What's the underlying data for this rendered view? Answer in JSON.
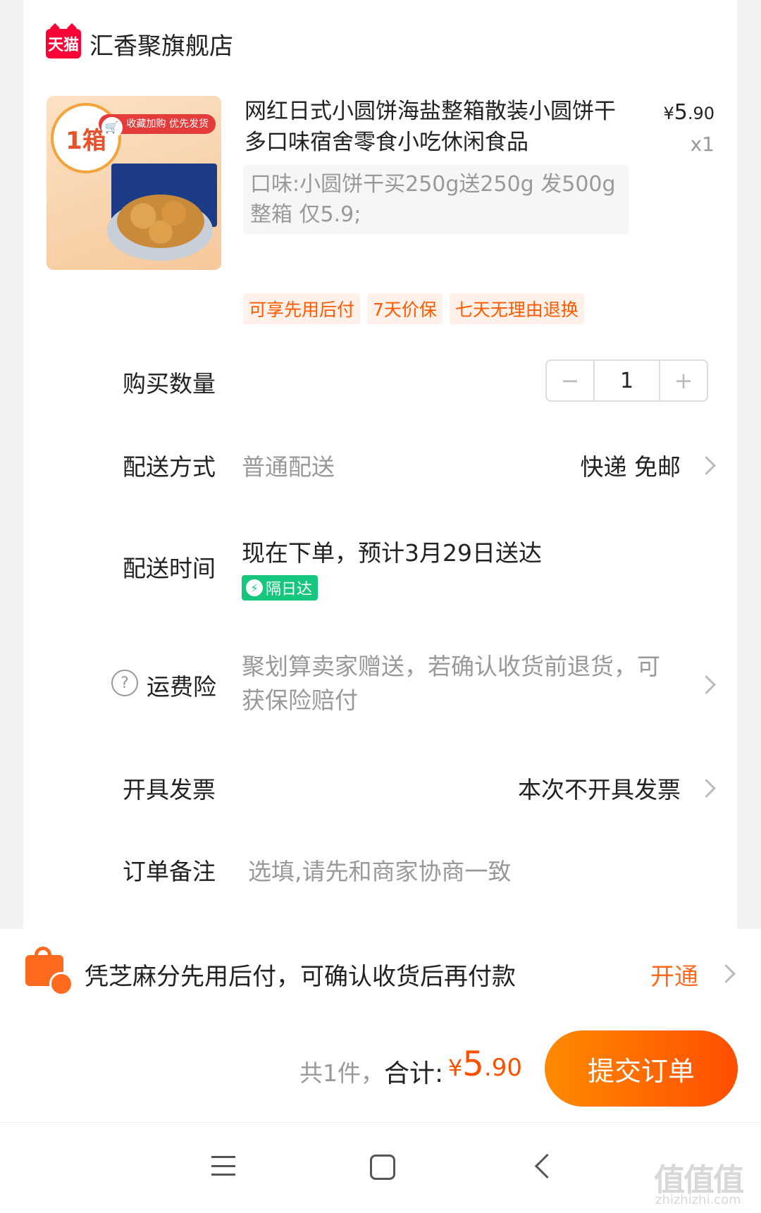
{
  "shop": {
    "logo_text": "天猫",
    "name": "汇香聚旗舰店"
  },
  "product": {
    "image_badge": "1箱",
    "image_tag": "收藏加购 优先发货",
    "title": "网红日式小圆饼海盐整箱散装小圆饼干多口味宿舍零食小吃休闲食品",
    "price_currency": "¥",
    "price_int": "5",
    "price_dec": ".90",
    "quantity": "x1",
    "sku": "口味:小圆饼干买250g送250g 发500g整箱 仅5.9;",
    "tags": [
      "可享先用后付",
      "7天价保",
      "七天无理由退换"
    ]
  },
  "quantity_row": {
    "label": "购买数量",
    "value": "1",
    "minus": "−",
    "plus": "+"
  },
  "delivery_method": {
    "label": "配送方式",
    "type": "普通配送",
    "value": "快递 免邮"
  },
  "delivery_time": {
    "label": "配送时间",
    "value": "现在下单，预计3月29日送达",
    "badge": "隔日达"
  },
  "shipping_insurance": {
    "label": "运费险",
    "value": "聚划算卖家赠送，若确认收货前退货，可获保险赔付"
  },
  "invoice": {
    "label": "开具发票",
    "value": "本次不开具发票"
  },
  "order_note": {
    "label": "订单备注",
    "placeholder": "选填,请先和商家协商一致"
  },
  "pay_later": {
    "text": "凭芝麻分先用后付，可确认收货后再付款",
    "action": "开通"
  },
  "footer": {
    "count_text": "共1件，",
    "total_label": "合计:",
    "currency": "¥",
    "amount_int": "5",
    "amount_dec": ".90",
    "submit_label": "提交订单"
  },
  "watermark": {
    "main": "值值值",
    "sub": "zhizhizhi.com"
  },
  "colors": {
    "accent": "#ff5000",
    "tmall_red": "#ff0036",
    "nextday_green": "#15c67c"
  },
  "icons": [
    "tmall-logo-icon",
    "minus-icon",
    "plus-icon",
    "chevron-right-icon",
    "help-circle-icon",
    "lightning-icon",
    "shopping-bag-icon",
    "menu-icon",
    "home-icon",
    "back-icon"
  ]
}
